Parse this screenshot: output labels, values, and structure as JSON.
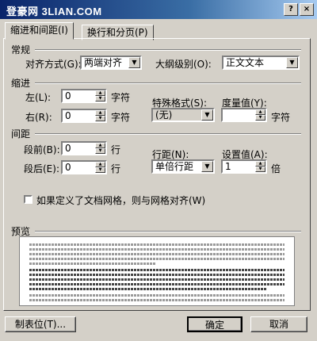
{
  "window": {
    "title": "登豪网 3LIAN.COM",
    "help_label": "?",
    "close_label": "×"
  },
  "tabs": [
    {
      "label": "缩进和间距(I)",
      "active": true
    },
    {
      "label": "换行和分页(P)",
      "active": false
    }
  ],
  "general": {
    "heading": "常规",
    "alignment_label": "对齐方式(G):",
    "alignment_value": "两端对齐",
    "outline_label": "大纲级别(O):",
    "outline_value": "正文文本"
  },
  "indent": {
    "heading": "缩进",
    "left_label": "左(L):",
    "left_value": "0",
    "left_unit": "字符",
    "right_label": "右(R):",
    "right_value": "0",
    "right_unit": "字符",
    "special_label": "特殊格式(S):",
    "special_value": "(无)",
    "by_label": "度量值(Y):",
    "by_value": "",
    "by_unit": "字符"
  },
  "spacing": {
    "heading": "间距",
    "before_label": "段前(B):",
    "before_value": "0",
    "before_unit": "行",
    "after_label": "段后(E):",
    "after_value": "0",
    "after_unit": "行",
    "line_label": "行距(N):",
    "line_value": "单倍行距",
    "at_label": "设置值(A):",
    "at_value": "1",
    "at_unit": "倍"
  },
  "grid_option": {
    "label": "如果定义了文档网格，则与网格对齐(W)",
    "checked": false
  },
  "preview": {
    "heading": "预览"
  },
  "footer": {
    "tabs_label": "制表位(T)...",
    "ok_label": "确定",
    "cancel_label": "取消"
  }
}
